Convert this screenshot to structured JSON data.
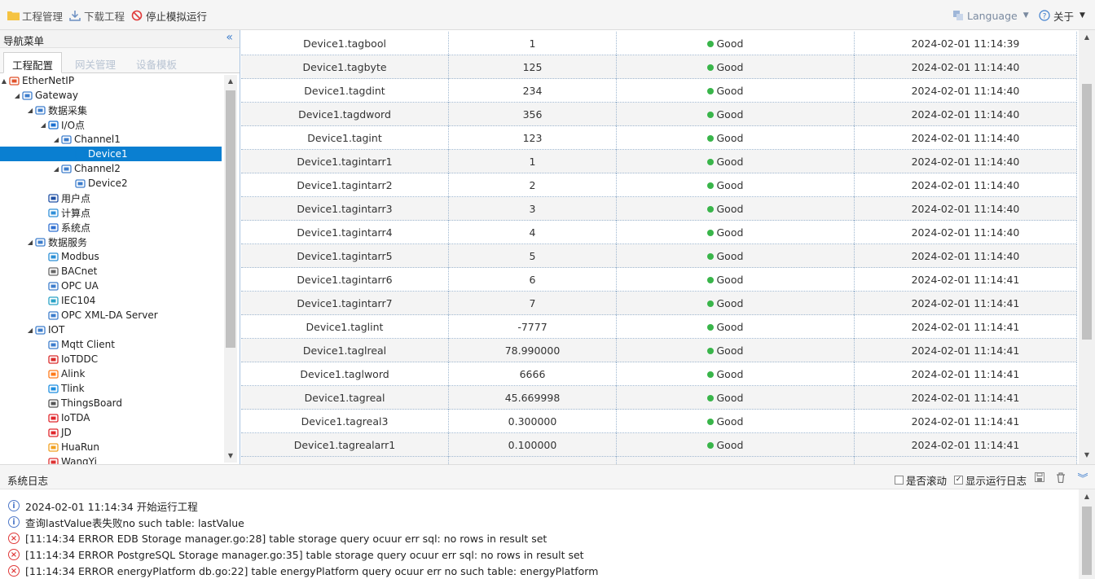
{
  "toolbar": {
    "project_label": "工程管理",
    "download_label": "下载工程",
    "stop_label": "停止模拟运行",
    "language_label": "Language",
    "about_label": "关于"
  },
  "sidebar": {
    "title": "导航菜单",
    "tabs": [
      "工程配置",
      "网关管理",
      "设备模板"
    ],
    "tree": [
      {
        "label": "EtherNetIP",
        "icon": "layers-icon",
        "toggle": "▲"
      },
      {
        "label": "Gateway",
        "icon": "gateway-icon",
        "toggle": "◢"
      },
      {
        "label": "数据采集",
        "icon": "chart-icon",
        "toggle": "◢"
      },
      {
        "label": "I/O点",
        "icon": "io-icon",
        "toggle": "◢"
      },
      {
        "label": "Channel1",
        "icon": "network-icon",
        "toggle": "◢"
      },
      {
        "label": "Device1",
        "icon": "device-icon",
        "toggle": ""
      },
      {
        "label": "Channel2",
        "icon": "network-icon",
        "toggle": "◢"
      },
      {
        "label": "Device2",
        "icon": "device-icon",
        "toggle": ""
      },
      {
        "label": "用户点",
        "icon": "user-point-icon",
        "toggle": ""
      },
      {
        "label": "计算点",
        "icon": "calc-icon",
        "toggle": ""
      },
      {
        "label": "系统点",
        "icon": "system-icon",
        "toggle": ""
      },
      {
        "label": "数据服务",
        "icon": "share-icon",
        "toggle": "◢"
      },
      {
        "label": "Modbus",
        "icon": "modbus-icon",
        "toggle": ""
      },
      {
        "label": "BACnet",
        "icon": "bacnet-icon",
        "toggle": ""
      },
      {
        "label": "OPC UA",
        "icon": "opcua-icon",
        "toggle": ""
      },
      {
        "label": "IEC104",
        "icon": "iec-icon",
        "toggle": ""
      },
      {
        "label": "OPC XML-DA Server",
        "icon": "opcxml-icon",
        "toggle": ""
      },
      {
        "label": "IOT",
        "icon": "iot-icon",
        "toggle": "◢"
      },
      {
        "label": "Mqtt Client",
        "icon": "mqtt-icon",
        "toggle": ""
      },
      {
        "label": "IoTDDC",
        "icon": "iotddc-icon",
        "toggle": ""
      },
      {
        "label": "Alink",
        "icon": "alink-icon",
        "toggle": ""
      },
      {
        "label": "Tlink",
        "icon": "tlink-icon",
        "toggle": ""
      },
      {
        "label": "ThingsBoard",
        "icon": "thingsboard-icon",
        "toggle": ""
      },
      {
        "label": "IoTDA",
        "icon": "huawei-icon",
        "toggle": ""
      },
      {
        "label": "JD",
        "icon": "jd-icon",
        "toggle": ""
      },
      {
        "label": "HuaRun",
        "icon": "huarun-icon",
        "toggle": ""
      },
      {
        "label": "WangYi",
        "icon": "wangyi-icon",
        "toggle": ""
      }
    ]
  },
  "grid": {
    "rows": [
      {
        "name": "Device1.tagbool",
        "value": "1",
        "quality": "Good",
        "time": "2024-02-01 11:14:39"
      },
      {
        "name": "Device1.tagbyte",
        "value": "125",
        "quality": "Good",
        "time": "2024-02-01 11:14:40"
      },
      {
        "name": "Device1.tagdint",
        "value": "234",
        "quality": "Good",
        "time": "2024-02-01 11:14:40"
      },
      {
        "name": "Device1.tagdword",
        "value": "356",
        "quality": "Good",
        "time": "2024-02-01 11:14:40"
      },
      {
        "name": "Device1.tagint",
        "value": "123",
        "quality": "Good",
        "time": "2024-02-01 11:14:40"
      },
      {
        "name": "Device1.tagintarr1",
        "value": "1",
        "quality": "Good",
        "time": "2024-02-01 11:14:40"
      },
      {
        "name": "Device1.tagintarr2",
        "value": "2",
        "quality": "Good",
        "time": "2024-02-01 11:14:40"
      },
      {
        "name": "Device1.tagintarr3",
        "value": "3",
        "quality": "Good",
        "time": "2024-02-01 11:14:40"
      },
      {
        "name": "Device1.tagintarr4",
        "value": "4",
        "quality": "Good",
        "time": "2024-02-01 11:14:40"
      },
      {
        "name": "Device1.tagintarr5",
        "value": "5",
        "quality": "Good",
        "time": "2024-02-01 11:14:40"
      },
      {
        "name": "Device1.tagintarr6",
        "value": "6",
        "quality": "Good",
        "time": "2024-02-01 11:14:41"
      },
      {
        "name": "Device1.tagintarr7",
        "value": "7",
        "quality": "Good",
        "time": "2024-02-01 11:14:41"
      },
      {
        "name": "Device1.taglint",
        "value": "-7777",
        "quality": "Good",
        "time": "2024-02-01 11:14:41"
      },
      {
        "name": "Device1.taglreal",
        "value": "78.990000",
        "quality": "Good",
        "time": "2024-02-01 11:14:41"
      },
      {
        "name": "Device1.taglword",
        "value": "6666",
        "quality": "Good",
        "time": "2024-02-01 11:14:41"
      },
      {
        "name": "Device1.tagreal",
        "value": "45.669998",
        "quality": "Good",
        "time": "2024-02-01 11:14:41"
      },
      {
        "name": "Device1.tagreal3",
        "value": "0.300000",
        "quality": "Good",
        "time": "2024-02-01 11:14:41"
      },
      {
        "name": "Device1.tagrealarr1",
        "value": "0.100000",
        "quality": "Good",
        "time": "2024-02-01 11:14:41"
      }
    ]
  },
  "log": {
    "title": "系统日志",
    "scroll_label": "是否滚动",
    "scroll_checked": false,
    "show_label": "显示运行日志",
    "show_checked": true,
    "lines": [
      {
        "level": "info",
        "text": "2024-02-01 11:14:34 开始运行工程"
      },
      {
        "level": "info",
        "text": "查询lastValue表失败no such table: lastValue"
      },
      {
        "level": "error",
        "text": "[11:14:34 ERROR EDB Storage manager.go:28] table storage query ocuur err sql: no rows in result set"
      },
      {
        "level": "error",
        "text": "[11:14:34 ERROR PostgreSQL Storage manager.go:35] table storage query ocuur err sql: no rows in result set"
      },
      {
        "level": "error",
        "text": "[11:14:34 ERROR energyPlatform db.go:22] table energyPlatform query ocuur err no such table: energyPlatform"
      }
    ]
  },
  "colors": {
    "selection": "#0a7fd1",
    "good": "#39b54a",
    "info": "#4f79c9",
    "error": "#e03a3a"
  }
}
